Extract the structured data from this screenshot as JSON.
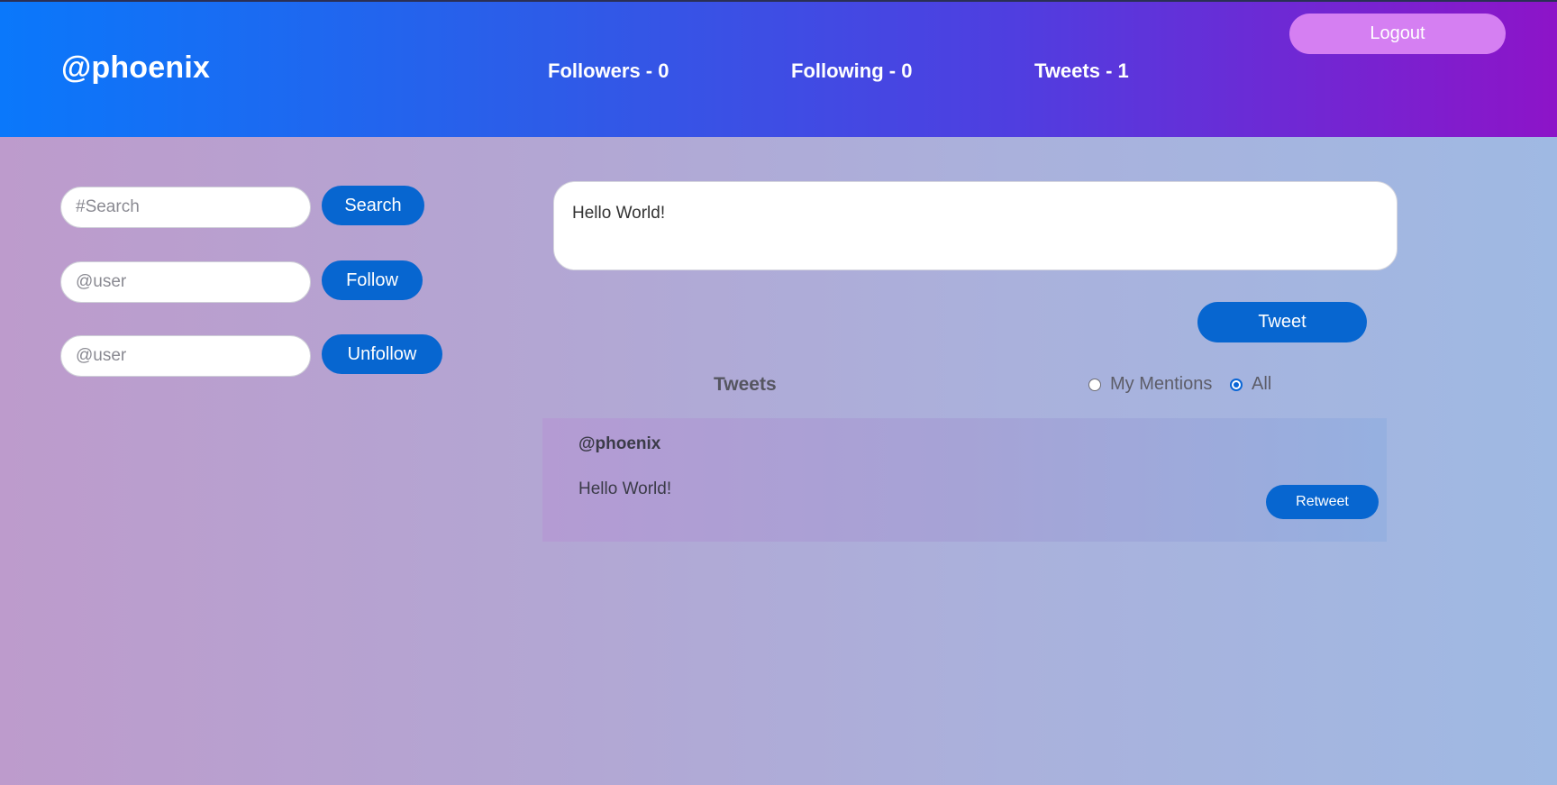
{
  "header": {
    "username": "@phoenix",
    "stats": {
      "followers": "Followers - 0",
      "following": "Following - 0",
      "tweets": "Tweets - 1"
    },
    "logout_label": "Logout"
  },
  "sidebar": {
    "search": {
      "placeholder": "#Search",
      "value": "",
      "button_label": "Search"
    },
    "follow": {
      "placeholder": "@user",
      "value": "",
      "button_label": "Follow"
    },
    "unfollow": {
      "placeholder": "@user",
      "value": "",
      "button_label": "Unfollow"
    }
  },
  "composer": {
    "value": "Hello World!",
    "button_label": "Tweet"
  },
  "feed": {
    "heading": "Tweets",
    "filters": [
      {
        "label": "My Mentions",
        "checked": false
      },
      {
        "label": "All",
        "checked": true
      }
    ],
    "tweets": [
      {
        "author": "@phoenix",
        "text": "Hello World!",
        "retweet_label": "Retweet"
      }
    ]
  },
  "colors": {
    "header_gradient_start": "#0a78fb",
    "header_gradient_end": "#8d14c8",
    "primary_button": "#0766d0",
    "logout_button": "#d57ff2"
  }
}
